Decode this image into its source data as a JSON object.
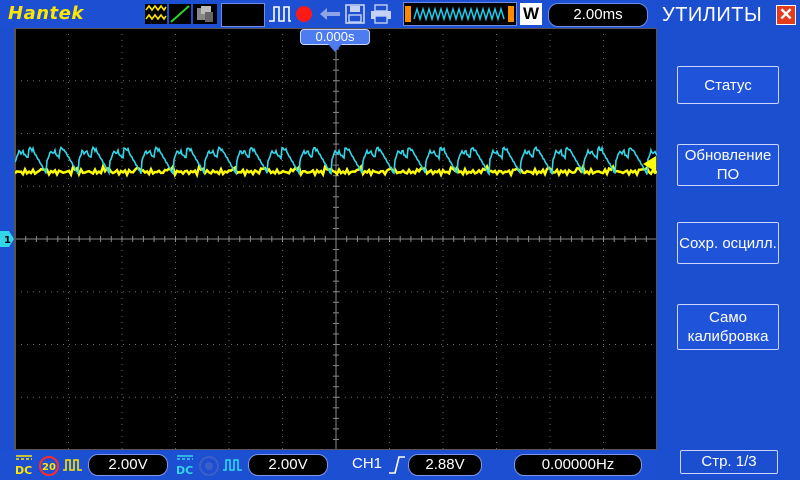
{
  "app": {
    "brand": "Hantek"
  },
  "toolbar": {
    "icons": [
      "waveform-display-icon",
      "line-mode-icon",
      "persistence-icon",
      "trigger-edge-icon",
      "record-icon",
      "arrow-icon",
      "save-icon",
      "printer-icon",
      "memory-depth-icon"
    ],
    "timebase": "2.00ms",
    "mode_letter": "W"
  },
  "trigger_marker": {
    "label": "0.000s"
  },
  "panel": {
    "title": "УТИЛИТЫ",
    "buttons": [
      {
        "label": "Статус"
      },
      {
        "label": "Обновление ПО"
      },
      {
        "label": "Сохр. осцилл."
      },
      {
        "label": "Само калибровка"
      }
    ],
    "page": "Стр.   1/3"
  },
  "status_bar": {
    "ch1_coupling": "DC",
    "ch1_bw_limit": "20",
    "ch1_volts": "2.00V",
    "ch2_coupling": "DC",
    "ch2_volts": "2.00V",
    "trigger_source": "CH1",
    "trigger_level": "2.88V",
    "frequency": "0.00000Hz"
  },
  "colors": {
    "ch1": "#ffff00",
    "ch2": "#33d6e8",
    "accent": "#1d4fd2",
    "record": "#ff1a1a",
    "close": "#e43b1c"
  }
}
